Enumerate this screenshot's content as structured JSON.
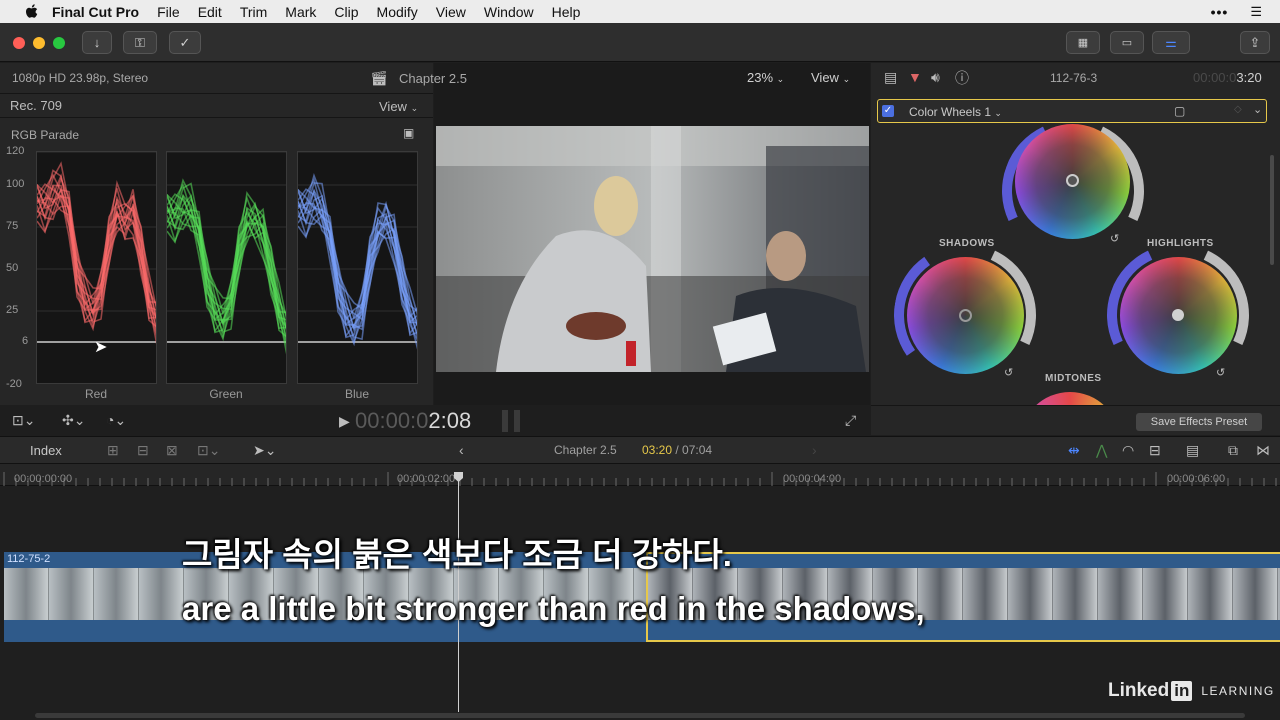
{
  "menubar": {
    "app_name": "Final Cut Pro",
    "items": [
      "File",
      "Edit",
      "Trim",
      "Mark",
      "Clip",
      "Modify",
      "View",
      "Window",
      "Help"
    ]
  },
  "browser_header": {
    "format": "1080p HD 23.98p, Stereo"
  },
  "scopes": {
    "colorspace": "Rec. 709",
    "view_label": "View",
    "scope_name": "RGB Parade",
    "y_ticks": [
      "120",
      "100",
      "75",
      "50",
      "25",
      "6",
      "-20"
    ],
    "channels": [
      "Red",
      "Green",
      "Blue"
    ],
    "colors": {
      "red": "#ff6b6b",
      "green": "#58e05a",
      "blue": "#7aa2ff"
    }
  },
  "viewer": {
    "title": "Chapter 2.5",
    "zoom": "23%",
    "view_label": "View",
    "timecode_dim": "00:00:0",
    "timecode": "2:08"
  },
  "inspector": {
    "clip_name": "112-76-3",
    "duration_dim": "00:00:0",
    "duration": "3:20",
    "effect_name": "Color Wheels 1",
    "labels": {
      "shadows": "SHADOWS",
      "highlights": "HIGHLIGHTS",
      "midtones": "MIDTONES"
    },
    "save_preset": "Save Effects Preset",
    "accent_color": "#e6c84a"
  },
  "timeline": {
    "index_label": "Index",
    "chapter": "Chapter 2.5",
    "position": "03:20",
    "total": "/ 07:04",
    "ruler": [
      "00:00:00:00",
      "00:00:02:00",
      "00:00:04:00",
      "00:00:06:00"
    ],
    "clip1_name": "112-75-2"
  },
  "subtitles": {
    "korean": "그림자 속의 붉은 색보다 조금 더 강하다.",
    "english": "are a little bit stronger than red in the shadows,"
  },
  "watermark": {
    "brand": "Linked",
    "brand_in": "in",
    "learning": "LEARNING"
  }
}
